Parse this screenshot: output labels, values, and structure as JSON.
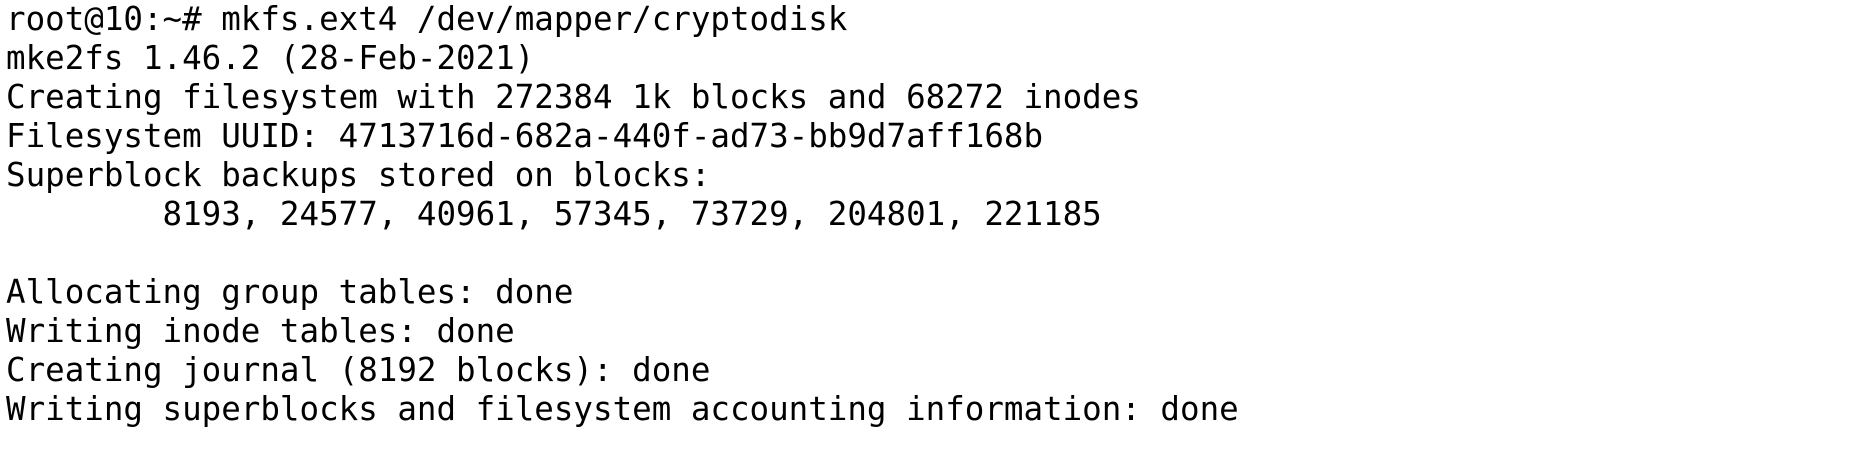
{
  "terminal": {
    "lines": [
      "root@10:~# mkfs.ext4 /dev/mapper/cryptodisk",
      "mke2fs 1.46.2 (28-Feb-2021)",
      "Creating filesystem with 272384 1k blocks and 68272 inodes",
      "Filesystem UUID: 4713716d-682a-440f-ad73-bb9d7aff168b",
      "Superblock backups stored on blocks:",
      "        8193, 24577, 40961, 57345, 73729, 204801, 221185",
      "",
      "Allocating group tables: done",
      "Writing inode tables: done",
      "Creating journal (8192 blocks): done",
      "Writing superblocks and filesystem accounting information: done",
      ""
    ]
  }
}
